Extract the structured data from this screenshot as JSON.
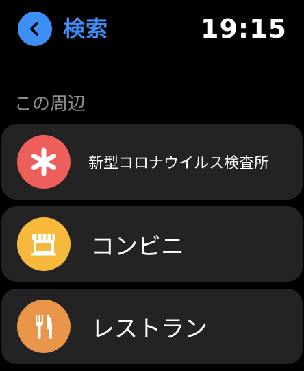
{
  "header": {
    "back_label": "検索",
    "time": "19:15",
    "accent_color": "#3e8ef7"
  },
  "section": {
    "title": "この周辺"
  },
  "items": [
    {
      "label": "新型コロナウイルス検査所",
      "icon": "asterisk-icon",
      "color": "#ee5f5b"
    },
    {
      "label": "コンビニ",
      "icon": "store-icon",
      "color": "#f6b93b"
    },
    {
      "label": "レストラン",
      "icon": "fork-knife-icon",
      "color": "#e9954a"
    }
  ]
}
